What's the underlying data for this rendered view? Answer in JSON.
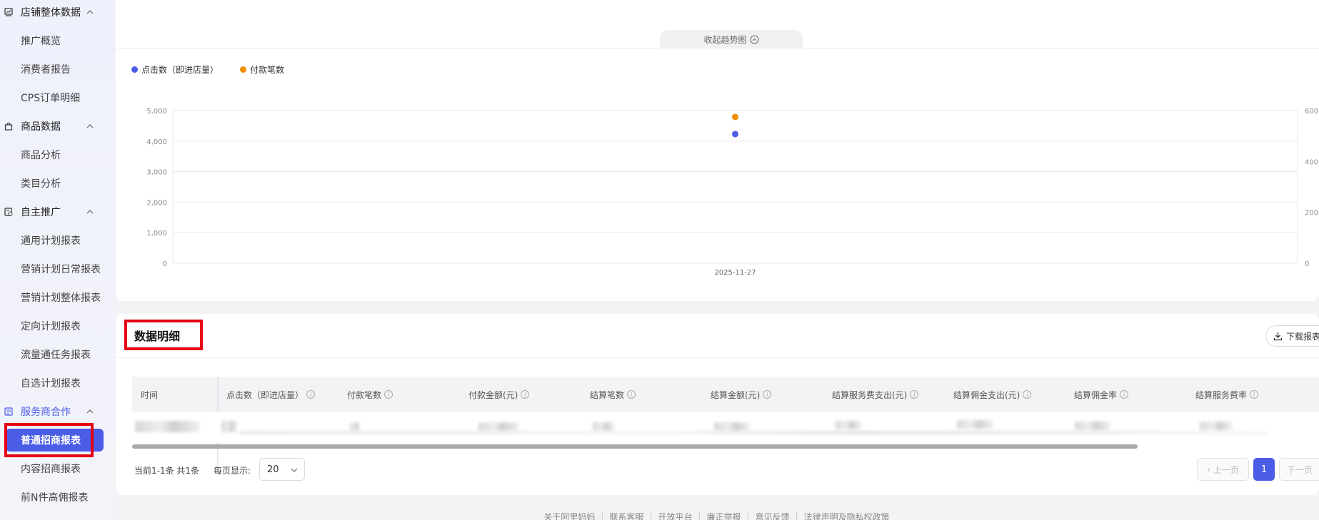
{
  "sidebar": {
    "groups": [
      {
        "label": "店铺整体数据",
        "icon": "store-data-icon"
      },
      {
        "label": "商品数据",
        "icon": "bag-icon"
      },
      {
        "label": "自主推广",
        "icon": "promotion-icon"
      },
      {
        "label": "服务商合作",
        "icon": "partner-icon"
      }
    ],
    "items": [
      "推广概览",
      "消费者报告",
      "CPS订单明细",
      "商品分析",
      "类目分析",
      "通用计划报表",
      "营销计划日常报表",
      "营销计划整体报表",
      "定向计划报表",
      "流量通任务报表",
      "自选计划报表",
      "普通招商报表",
      "内容招商报表",
      "前N件高佣报表"
    ],
    "active_item": "普通招商报表",
    "active_group": "服务商合作",
    "accent_color": "#4b5ce6"
  },
  "chart": {
    "collapse_label": "收起趋势图",
    "legend": [
      "点击数（即进店量）",
      "付款笔数"
    ]
  },
  "chart_data": {
    "type": "scatter",
    "x": [
      "2025-11-27"
    ],
    "series": [
      {
        "name": "点击数（即进店量）",
        "axis": "left",
        "color": "#4b5ce6",
        "values": [
          4230
        ]
      },
      {
        "name": "付款笔数",
        "axis": "right",
        "color": "#f08c00",
        "values": [
          575
        ]
      }
    ],
    "y_left": {
      "ticks": [
        "5,000",
        "4,000",
        "3,000",
        "2,000",
        "1,000",
        "0"
      ],
      "ylim": [
        0,
        5000
      ]
    },
    "y_right": {
      "ticks": [
        "600",
        "400",
        "200",
        "0"
      ],
      "ylim": [
        0,
        600
      ]
    },
    "grid": true,
    "legend_position": "top-left",
    "title": "",
    "xlabel": "",
    "ylabel": ""
  },
  "detail": {
    "title": "数据明细",
    "download_label": "下载报表",
    "columns": [
      "时间",
      "点击数（即进店量）",
      "付款笔数",
      "付款金额(元)",
      "结算笔数",
      "结算金额(元)",
      "结算服务费支出(元)",
      "结算佣金支出(元)",
      "结算佣金率",
      "结算服务费率"
    ]
  },
  "pager": {
    "info": "当前1-1条 共1条",
    "pagesize_label": "每页显示:",
    "pagesize_value": "20",
    "prev_label": "上一页",
    "current_page": "1",
    "next_label": "下一页"
  },
  "footer": {
    "links": [
      "关于阿里妈妈",
      "联系客服",
      "开放平台",
      "廉正举报",
      "意见反馈",
      "法律声明及隐私权政策"
    ]
  }
}
